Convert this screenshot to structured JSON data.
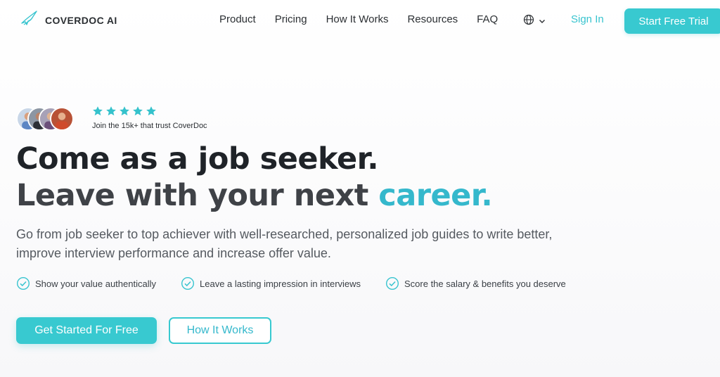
{
  "brand": {
    "name": "COVERDOC AI",
    "accent_color": "#38c9d0"
  },
  "nav": {
    "items": [
      "Product",
      "Pricing",
      "How It Works",
      "Resources",
      "FAQ"
    ],
    "language_icon": "globe-icon",
    "sign_in": "Sign In",
    "trial_button": "Start Free Trial"
  },
  "social_proof": {
    "rating_stars": 5,
    "text": "Join the 15k+ that trust CoverDoc"
  },
  "hero": {
    "headline_line1": "Come as a job seeker.",
    "headline_line2_prefix": "Leave with your next",
    "headline_line2_accent": "career.",
    "lead": "Go from job seeker to top achiever with well-researched, personalized job guides to write better, improve interview performance and increase offer value.",
    "benefits": [
      "Show your value authentically",
      "Leave a lasting impression in interviews",
      "Score the salary & benefits you deserve"
    ],
    "primary_cta": "Get Started For Free",
    "secondary_cta": "How It Works"
  }
}
